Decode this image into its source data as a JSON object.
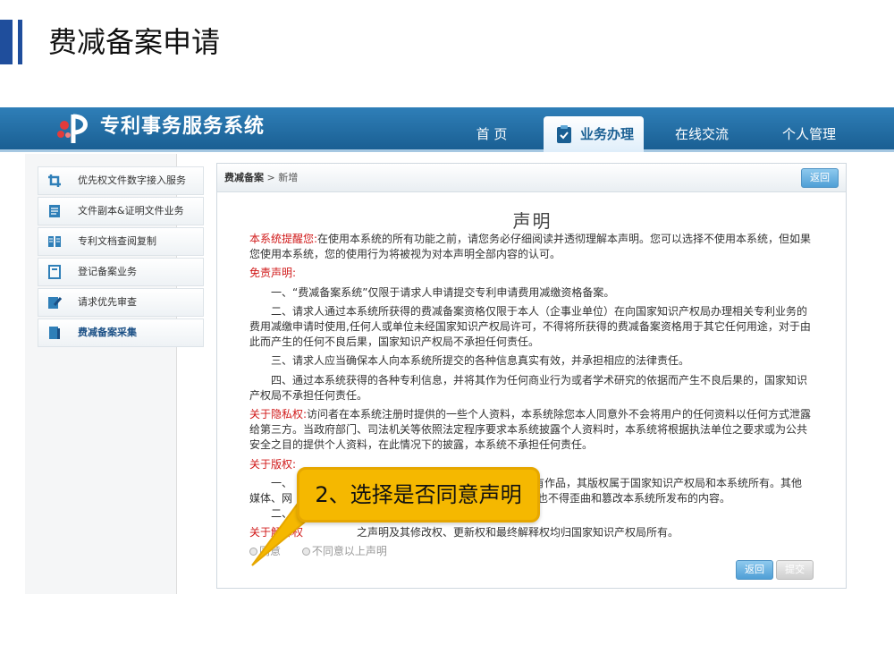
{
  "slide": {
    "title": "费减备案申请"
  },
  "header": {
    "system_name": "专利事务服务系统",
    "nav": [
      {
        "label": "首 页"
      },
      {
        "label": "业务办理"
      },
      {
        "label": "在线交流"
      },
      {
        "label": "个人管理"
      }
    ]
  },
  "sidebar": {
    "items": [
      {
        "label": "优先权文件数字接入服务",
        "icon": "crop-icon"
      },
      {
        "label": "文件副本&证明文件业务",
        "icon": "document-icon"
      },
      {
        "label": "专利文档查阅复制",
        "icon": "book-icon"
      },
      {
        "label": "登记备案业务",
        "icon": "register-icon"
      },
      {
        "label": "请求优先审查",
        "icon": "edit-icon"
      },
      {
        "label": "费减备案采集",
        "icon": "folder-icon"
      }
    ]
  },
  "panel": {
    "breadcrumb_root": "费减备案",
    "breadcrumb_sep": " > ",
    "breadcrumb_current": "新增",
    "return_label": "返回",
    "submit_label": "提交",
    "title": "声明",
    "reminder_label": "本系统提醒您:",
    "reminder_text": "在使用本系统的所有功能之前，请您务必仔细阅读并透彻理解本声明。您可以选择不使用本系统，但如果您使用本系统，您的使用行为将被视为对本声明全部内容的认可。",
    "disclaimer_label": "免责声明:",
    "disclaimer_1": "一、“费减备案系统”仅限于请求人申请提交专利申请费用减缴资格备案。",
    "disclaimer_2": "二、请求人通过本系统所获得的费减备案资格仅限于本人（企事业单位）在向国家知识产权局办理相关专利业务的费用减缴申请时使用,任何人或单位未经国家知识产权局许可，不得将所获得的费减备案资格用于其它任何用途，对于由此而产生的任何不良后果，国家知识产权局不承担任何责任。",
    "disclaimer_3": "三、请求人应当确保本人向本系统所提交的各种信息真实有效，并承担相应的法律责任。",
    "disclaimer_4": "四、通过本系统获得的各种专利信息，并将其作为任何商业行为或者学术研究的依据而产生不良后果的，国家知识产权局不承担任何责任。",
    "privacy_label": "关于隐私权:",
    "privacy_text": "访问者在本系统注册时提供的一些个人资料，本系统除您本人同意外不会将用户的任何资料以任何方式泄露给第三方。当政府部门、司法机关等依照法定程序要求本系统披露个人资料时，本系统将根据执法单位之要求或为公共安全之目的提供个人资料，在此情况下的披露，本系统不承担任何责任。",
    "copyright_label": "关于版权:",
    "copyright_1a": "一、",
    "copyright_1b": "有作品，其版权属于国家知识产权局和本系统所有。其他",
    "copyright_1c": "媒体、网",
    "copyright_1d": "载，也不得歪曲和篡改本系统所发布的内容。",
    "copyright_2": "二、",
    "interpret_label": "关于解释权",
    "interpret_text": "之声明及其修改权、更新权和最终解释权均归国家知识产权局所有。",
    "agree_label": "同意",
    "disagree_label": "不同意以上声明"
  },
  "callout": {
    "text": "2、选择是否同意声明"
  },
  "colors": {
    "accent": "#1f4e9c",
    "header_blue": "#1a5f93",
    "callout": "#f5b800",
    "warning_red": "#d01818"
  }
}
